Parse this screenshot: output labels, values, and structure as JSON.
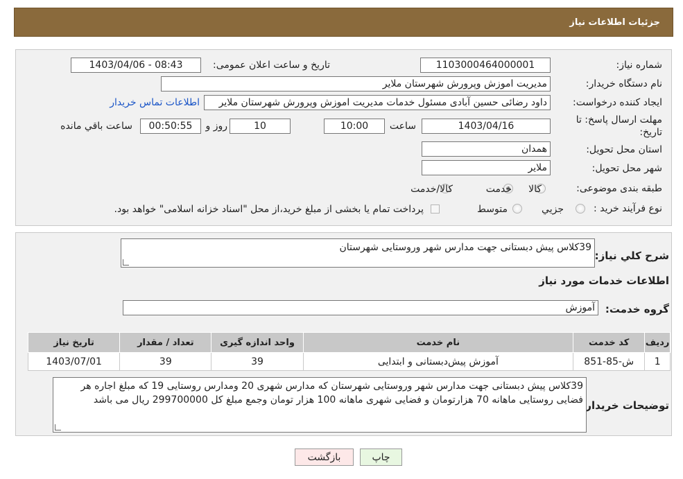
{
  "header": {
    "title": "جزئیات اطلاعات نیاز"
  },
  "fields": {
    "need_number": {
      "label": "شماره نیاز:",
      "value": "1103000464000001"
    },
    "announce": {
      "label": "تاریخ و ساعت اعلان عمومی:",
      "value": "1403/04/06 - 08:43"
    },
    "buyer_org": {
      "label": "نام دستگاه خریدار:",
      "value": "مدیریت اموزش وپرورش شهرستان ملایر"
    },
    "creator": {
      "label": "ایجاد کننده درخواست:",
      "value": "داود رضائی حسین آبادی مسئول خدمات مدیریت اموزش وپرورش شهرستان ملایر",
      "link": "اطلاعات تماس خریدار"
    },
    "deadline": {
      "label_line1": "مهلت ارسال پاسخ: تا",
      "label_line2": "تاریخ:",
      "date": "1403/04/16",
      "time_label": "ساعت",
      "time": "10:00",
      "days": "10",
      "days_label": "روز و",
      "remaining": "00:50:55",
      "remaining_label": "ساعت باقي مانده"
    },
    "province": {
      "label": "استان محل تحویل:",
      "value": "همدان"
    },
    "city": {
      "label": "شهر محل تحویل:",
      "value": "ملایر"
    },
    "category": {
      "label": "طبقه بندی موضوعی:",
      "options": [
        "کالا",
        "خدمت",
        "کالا/خدمت"
      ],
      "selected": "خدمت"
    },
    "process": {
      "label": "نوع فرآیند خرید :",
      "options": [
        "جزیي",
        "متوسط"
      ],
      "note": "پرداخت تمام یا بخشی از مبلغ خرید،از محل \"اسناد خزانه اسلامی\" خواهد بود."
    }
  },
  "summary": {
    "label": "شرح كلي نياز:",
    "value": "39کلاس پیش دبستانی جهت مدارس شهر وروستایی شهرستان",
    "services_title": "اطلاعات خدمات مورد نياز",
    "group_label": "گروه خدمت:",
    "group_value": "آموزش"
  },
  "table": {
    "headers": [
      "ردیف",
      "کد خدمت",
      "نام خدمت",
      "واحد اندازه گیری",
      "تعداد / مقدار",
      "تاریخ نیاز"
    ],
    "rows": [
      [
        "1",
        "ش-85-851",
        "آموزش پیش‌دبستانی و ابتدایی",
        "39",
        "39",
        "1403/07/01"
      ]
    ]
  },
  "buyer_notes": {
    "label": "توضیحات خریدار:",
    "value": "39کلاس پیش دبستانی جهت مدارس شهر وروستایی شهرستان که مدارس شهری 20 ومدارس روستایی 19 که مبلغ اجاره هر فضایی روستایی ماهانه 70 هزارتومان و فضایی شهری ماهانه 100 هزار تومان وجمع مبلغ کل 299700000 ریال می باشد"
  },
  "buttons": {
    "print": "چاپ",
    "back": "بازگشت"
  },
  "colors": {
    "header_bg": "#8a6a3c",
    "panel_bg": "#f1f1f1",
    "link": "#1a55c7",
    "back_bg": "#fde8e8",
    "print_bg": "#e8f7e1"
  }
}
